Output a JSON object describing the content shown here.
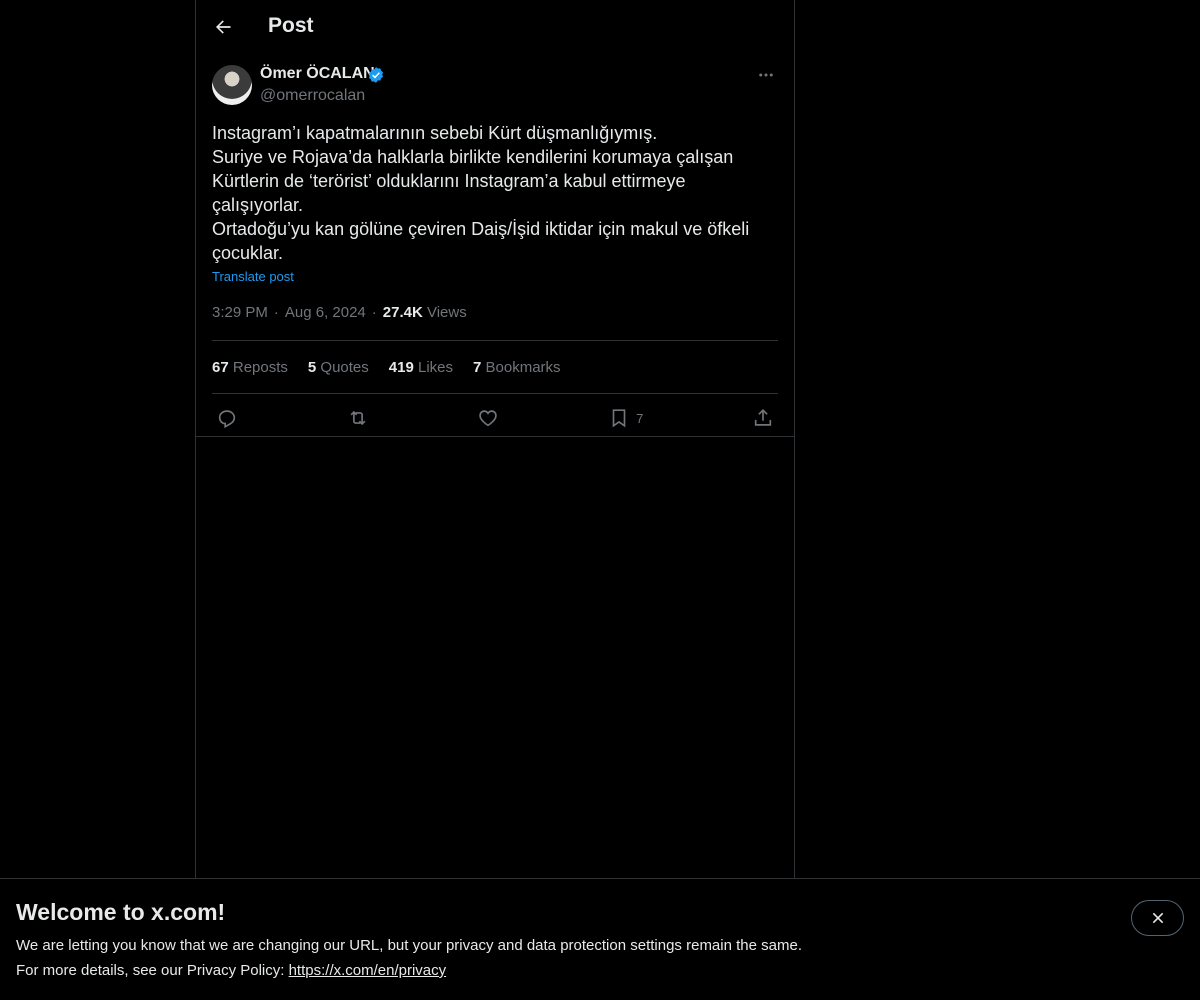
{
  "header": {
    "title": "Post"
  },
  "post": {
    "author": {
      "name": "Ömer ÖCALAN",
      "handle": "@omerrocalan"
    },
    "text_lines": [
      "Instagram’ı kapatmalarının sebebi Kürt düşmanlığıymış.",
      "Suriye ve Rojava’da halklarla birlikte kendilerini korumaya çalışan",
      "Kürtlerin de ‘terörist’ olduklarını Instagram’a kabul ettirmeye",
      "çalışıyorlar.",
      "Ortadoğu’yu kan gölüne çeviren Daiş/İşid iktidar için makul ve öfkeli",
      "çocuklar."
    ],
    "translate_label": "Translate post",
    "time": "3:29 PM",
    "date": "Aug 6, 2024",
    "views_count": "27.4K",
    "views_label": "Views",
    "stats": {
      "reposts_count": "67",
      "reposts_label": "Reposts",
      "quotes_count": "5",
      "quotes_label": "Quotes",
      "likes_count": "419",
      "likes_label": "Likes",
      "bookmarks_count": "7",
      "bookmarks_label": "Bookmarks"
    },
    "actions": {
      "bookmark_count": "7"
    }
  },
  "banner": {
    "title": "Welcome to x.com!",
    "line1": "We are letting you know that we are changing our URL, but your privacy and data protection settings remain the same.",
    "line2_prefix": "For more details, see our Privacy Policy: ",
    "link": "https://x.com/en/privacy"
  },
  "colors": {
    "accent": "#1d9bf0",
    "background": "#000000",
    "text": "#e7e9ea",
    "muted": "#71767b",
    "border": "#2f3336"
  },
  "icons": [
    "back-arrow-icon",
    "verified-badge-icon",
    "more-icon",
    "reply-icon",
    "repost-icon",
    "like-icon",
    "bookmark-icon",
    "share-icon",
    "close-icon"
  ]
}
